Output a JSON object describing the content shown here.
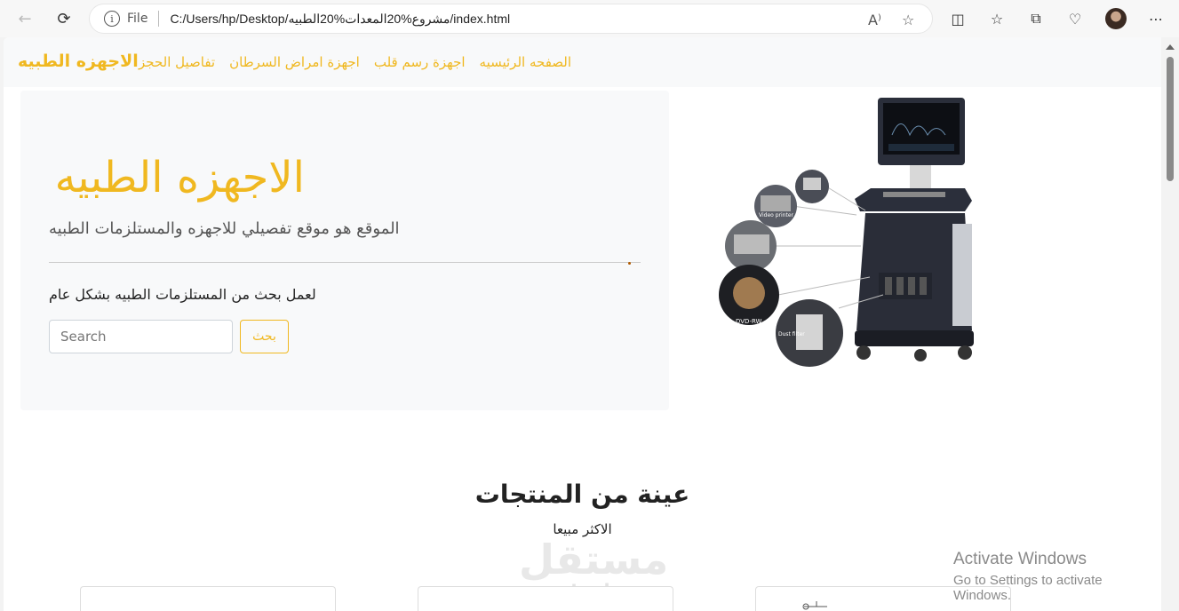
{
  "browser": {
    "file_label": "File",
    "url": "C:/Users/hp/Desktop/مشروع%20المعدات%20الطبيه/index.html"
  },
  "navbar": {
    "brand": "الاجهزه الطبيه",
    "links": [
      "الصفحه الرئيسيه",
      "اجهزة رسم قلب",
      "اجهزة امراض السرطان",
      "تفاصيل الحجز"
    ]
  },
  "hero": {
    "title": "الاجهزه الطبيه",
    "subtitle": "الموقع هو موقع تفصيلي للاجهزه والمستلزمات الطبيه",
    "text": "لعمل بحث من المستلزمات الطبيه بشكل عام",
    "search_placeholder": "Search",
    "search_button": "بحث"
  },
  "machine_labels": {
    "video_printer": "Video printer",
    "dvd": "DVD-RW",
    "dust_filter": "Dust filter"
  },
  "products": {
    "title": "عينة من المنتجات",
    "subtitle": "الاكثر مبيعا"
  },
  "watermark": {
    "arabic": "مستقل",
    "latin": "mostaql.com"
  },
  "activate": {
    "title": "Activate Windows",
    "message": "Go to Settings to activate Windows."
  },
  "colors": {
    "accent": "#f0b820",
    "navbar_bg": "#f8f9fa"
  }
}
